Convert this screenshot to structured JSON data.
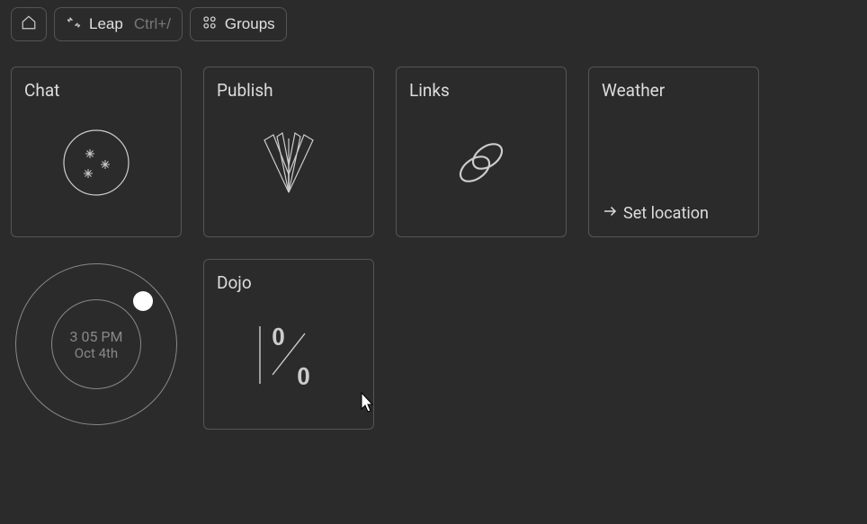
{
  "toolbar": {
    "leap_label": "Leap",
    "leap_hint": "Ctrl+/",
    "groups_label": "Groups"
  },
  "tiles": {
    "chat": {
      "title": "Chat"
    },
    "publish": {
      "title": "Publish"
    },
    "links": {
      "title": "Links"
    },
    "weather": {
      "title": "Weather",
      "action_label": "Set location"
    },
    "dojo": {
      "title": "Dojo",
      "top_value": "0",
      "bottom_value": "0"
    }
  },
  "clock": {
    "time": "3 05 PM",
    "date": "Oct 4th"
  }
}
